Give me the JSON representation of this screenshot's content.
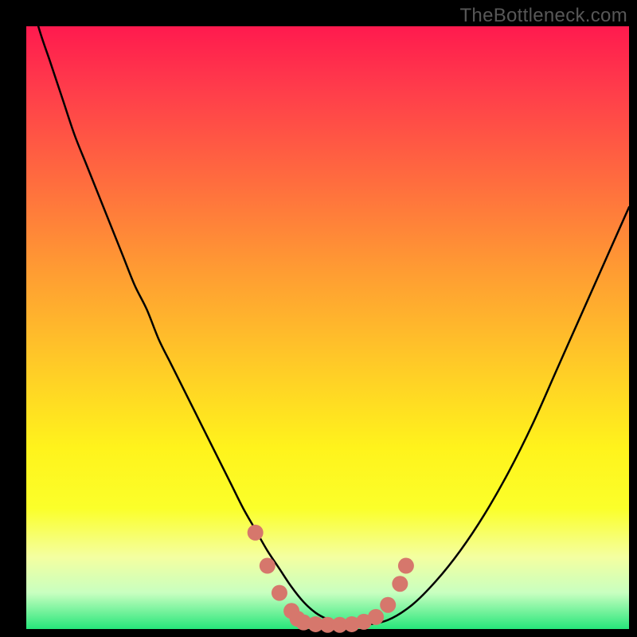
{
  "watermark": {
    "text": "TheBottleneck.com"
  },
  "colors": {
    "background": "#000000",
    "curve_stroke": "#000000",
    "marker_fill": "#d6776c",
    "gradient_top": "#ff1a4e",
    "gradient_bottom": "#26e67a"
  },
  "chart_data": {
    "type": "line",
    "title": "",
    "xlabel": "",
    "ylabel": "",
    "xlim": [
      0,
      100
    ],
    "ylim": [
      0,
      100
    ],
    "grid": false,
    "x": [
      0,
      2,
      4,
      6,
      8,
      10,
      12,
      14,
      16,
      18,
      20,
      22,
      24,
      26,
      28,
      30,
      32,
      34,
      36,
      38,
      40,
      42,
      44,
      46,
      48,
      50,
      52,
      56,
      60,
      64,
      68,
      72,
      76,
      80,
      84,
      88,
      92,
      96,
      100
    ],
    "values": [
      108,
      100,
      94,
      88,
      82,
      77,
      72,
      67,
      62,
      57,
      53,
      48,
      44,
      40,
      36,
      32,
      28,
      24,
      20,
      16.5,
      13,
      10,
      7,
      4.5,
      2.7,
      1.6,
      0.9,
      0.7,
      1.5,
      4,
      8,
      13,
      19,
      26,
      34,
      43,
      52,
      61,
      70
    ],
    "annotations": [
      {
        "x": 38,
        "y": 16.0,
        "kind": "dot"
      },
      {
        "x": 40,
        "y": 10.5,
        "kind": "dot"
      },
      {
        "x": 42,
        "y": 6.0,
        "kind": "dot"
      },
      {
        "x": 44,
        "y": 3.0,
        "kind": "dot"
      },
      {
        "x": 45,
        "y": 1.7,
        "kind": "dot"
      },
      {
        "x": 46,
        "y": 1.1,
        "kind": "dot"
      },
      {
        "x": 48,
        "y": 0.8,
        "kind": "dot"
      },
      {
        "x": 50,
        "y": 0.7,
        "kind": "dot"
      },
      {
        "x": 52,
        "y": 0.7,
        "kind": "dot"
      },
      {
        "x": 54,
        "y": 0.8,
        "kind": "dot"
      },
      {
        "x": 56,
        "y": 1.2,
        "kind": "dot"
      },
      {
        "x": 58,
        "y": 2.0,
        "kind": "dot"
      },
      {
        "x": 60,
        "y": 4.0,
        "kind": "dot"
      },
      {
        "x": 62,
        "y": 7.5,
        "kind": "dot"
      },
      {
        "x": 63,
        "y": 10.5,
        "kind": "dot"
      }
    ]
  }
}
